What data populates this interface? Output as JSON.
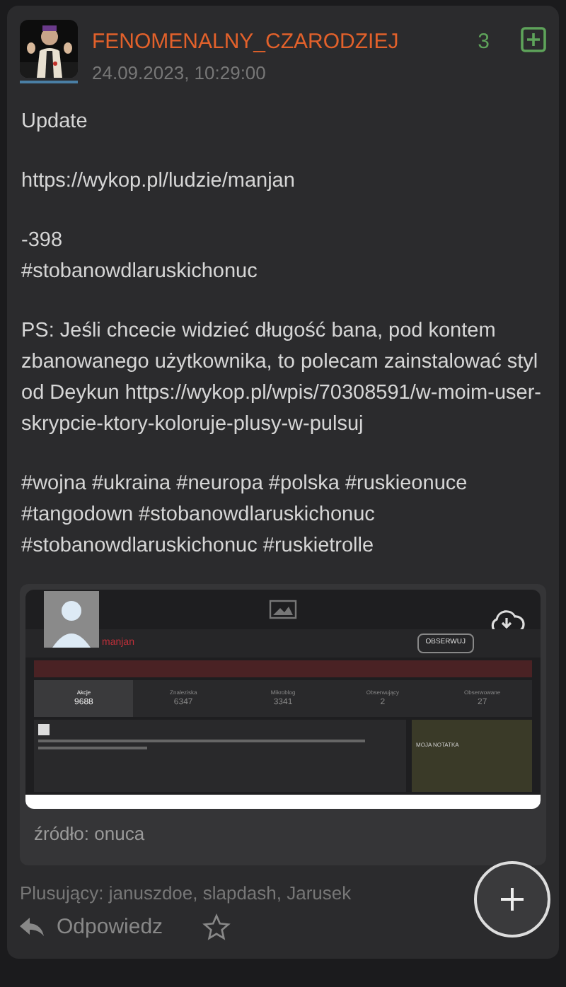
{
  "post": {
    "author": "FENOMENALNY_CZARODZIEJ",
    "date": "24.09.2023, 10:29:00",
    "votes": "3",
    "voted": false,
    "body": [
      "Update",
      "https://wykop.pl/ludzie/manjan",
      "-398\n#stobanowdlaruskichonuc",
      "PS: Jeśli chcecie widzieć długość bana, pod kontem zbanowanego użytkownika, to polecam zainstalować styl od Deykun https://wykop.pl/wpis/70308591/w-moim-user-skrypcie-ktory-koloruje-plusy-w-pulsuj",
      "#wojna #ukraina #neuropa #polska #ruskieonuce #tangodown #stobanowdlaruskichonuc #stobanowdlaruskichonuc #ruskietrolle"
    ],
    "attachment": {
      "source": "źródło: onuca",
      "screenshot": {
        "username": "manjan",
        "follow_button": "OBSERWUJ",
        "stats": [
          {
            "label": "Akcje",
            "value": "9688",
            "selected": true
          },
          {
            "label": "Znaleziska",
            "value": "6347",
            "selected": false
          },
          {
            "label": "Mikroblog",
            "value": "3341",
            "selected": false
          },
          {
            "label": "Obserwujący",
            "value": "2",
            "selected": false
          },
          {
            "label": "Obserwowane",
            "value": "27",
            "selected": false
          }
        ],
        "note_title": "MOJA NOTATKA"
      }
    },
    "plus_label": "Plusujący: januszdoe, slapdash, Jarusek",
    "reply": "Odpowiedz",
    "favorite": false
  }
}
